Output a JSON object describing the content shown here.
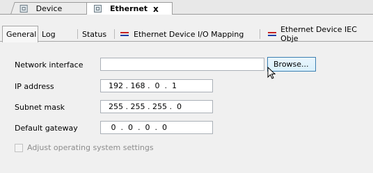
{
  "doc_tabs": [
    {
      "label": "Device"
    },
    {
      "label": "Ethernet",
      "close": "x"
    }
  ],
  "sub_tabs": [
    {
      "label": "General"
    },
    {
      "label": "Log"
    },
    {
      "label": "Status"
    },
    {
      "label": "Ethernet Device I/O Mapping"
    },
    {
      "label": "Ethernet Device IEC Obje"
    }
  ],
  "form": {
    "network_interface": {
      "label": "Network interface",
      "value": ""
    },
    "browse_label": "Browse...",
    "ip_address": {
      "label": "IP address",
      "value": "192 . 168 .  0  .  1"
    },
    "subnet_mask": {
      "label": "Subnet mask",
      "value": "255 . 255 . 255 .  0"
    },
    "default_gateway": {
      "label": "Default gateway",
      "value": " 0  .  0  .  0  .  0"
    },
    "adjust_os": {
      "label": "Adjust operating system settings",
      "checked": false,
      "enabled": false
    }
  },
  "colors": {
    "accent_red": "#c62020",
    "accent_blue": "#1f3fa6",
    "button_border": "#3c7fb1"
  }
}
